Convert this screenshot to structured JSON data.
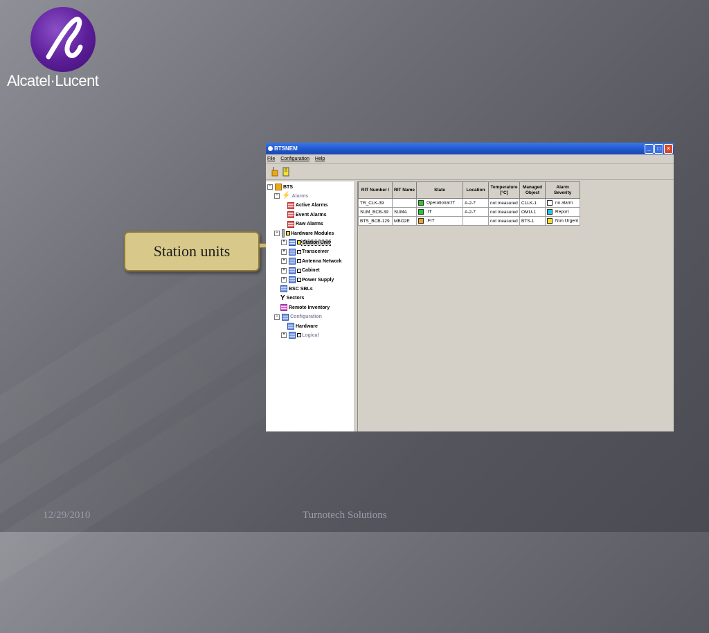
{
  "slide": {
    "logo_text": "Alcatel·Lucent",
    "footer_date": "12/29/2010",
    "footer_company": "Turnotech Solutions",
    "callout": "Station units"
  },
  "window": {
    "title": "BTSNEM",
    "menu": [
      "File",
      "Configuration",
      "Help"
    ],
    "tree": [
      {
        "label": "BTS",
        "exp": "⊟",
        "icon": "folder-icon",
        "level": 0
      },
      {
        "label": "Alarms",
        "exp": "⊟",
        "icon": "bolt-icon",
        "level": 1,
        "gray": true
      },
      {
        "label": "Active Alarms",
        "icon": "grid-icon",
        "level": 2
      },
      {
        "label": "Event Alarms",
        "icon": "grid-icon",
        "level": 2
      },
      {
        "label": "Raw Alarms",
        "icon": "grid-icon",
        "level": 2
      },
      {
        "label": "Hardware Modules",
        "exp": "⊟",
        "icon": "module-icon",
        "level": 1
      },
      {
        "label": "Station Unit",
        "exp": "⊞",
        "icon": "grid-icon",
        "level": 2,
        "selected": true
      },
      {
        "label": "Transceiver",
        "exp": "⊞",
        "icon": "grid-icon",
        "level": 2
      },
      {
        "label": "Antenna Network",
        "exp": "⊞",
        "icon": "grid-icon",
        "level": 2
      },
      {
        "label": "Cabinet",
        "exp": "⊞",
        "icon": "grid-icon",
        "level": 2
      },
      {
        "label": "Power Supply",
        "exp": "⊞",
        "icon": "grid-icon",
        "level": 2
      },
      {
        "label": "BSC SBLs",
        "icon": "grid-icon",
        "level": 1
      },
      {
        "label": "Sectors",
        "icon": "antenna-icon",
        "level": 1
      },
      {
        "label": "Remote Inventory",
        "icon": "grid-icon",
        "level": 1
      },
      {
        "label": "Configuration",
        "exp": "⊟",
        "icon": "grid-icon",
        "level": 1,
        "gray": true
      },
      {
        "label": "Hardware",
        "icon": "grid-icon",
        "level": 2
      },
      {
        "label": "Logical",
        "exp": "⊞",
        "icon": "grid-icon",
        "level": 2,
        "gray": true
      }
    ],
    "table": {
      "columns": [
        "RIT Number /",
        "RIT Name",
        "State",
        "Location",
        "Temperature [°C]",
        "Managed Object",
        "Alarm Severity"
      ],
      "rows": [
        {
          "rit_number": "TR_CLK-39",
          "rit_name": "",
          "state": "Operational:IT",
          "state_color": "#22cc22",
          "location": "A-2-7",
          "temperature": "not measured",
          "managed_object": "CLLK-1",
          "alarm": "no alarm",
          "alarm_color": "#ffffff"
        },
        {
          "rit_number": "SUM_BCB-39",
          "rit_name": "SUMA",
          "state": ":IT",
          "state_color": "#22cc22",
          "location": "A-2-7",
          "temperature": "not measured",
          "managed_object": "OMU-1",
          "alarm": "Report",
          "alarm_color": "#22c8e0"
        },
        {
          "rit_number": "BTS_BCB-129",
          "rit_name": "MBO2E",
          "state": ":FIT",
          "state_color": "#f0a020",
          "location": "",
          "temperature": "not measured",
          "managed_object": "BTS-1",
          "alarm": "Non Urgent",
          "alarm_color": "#f0e020"
        }
      ]
    }
  }
}
